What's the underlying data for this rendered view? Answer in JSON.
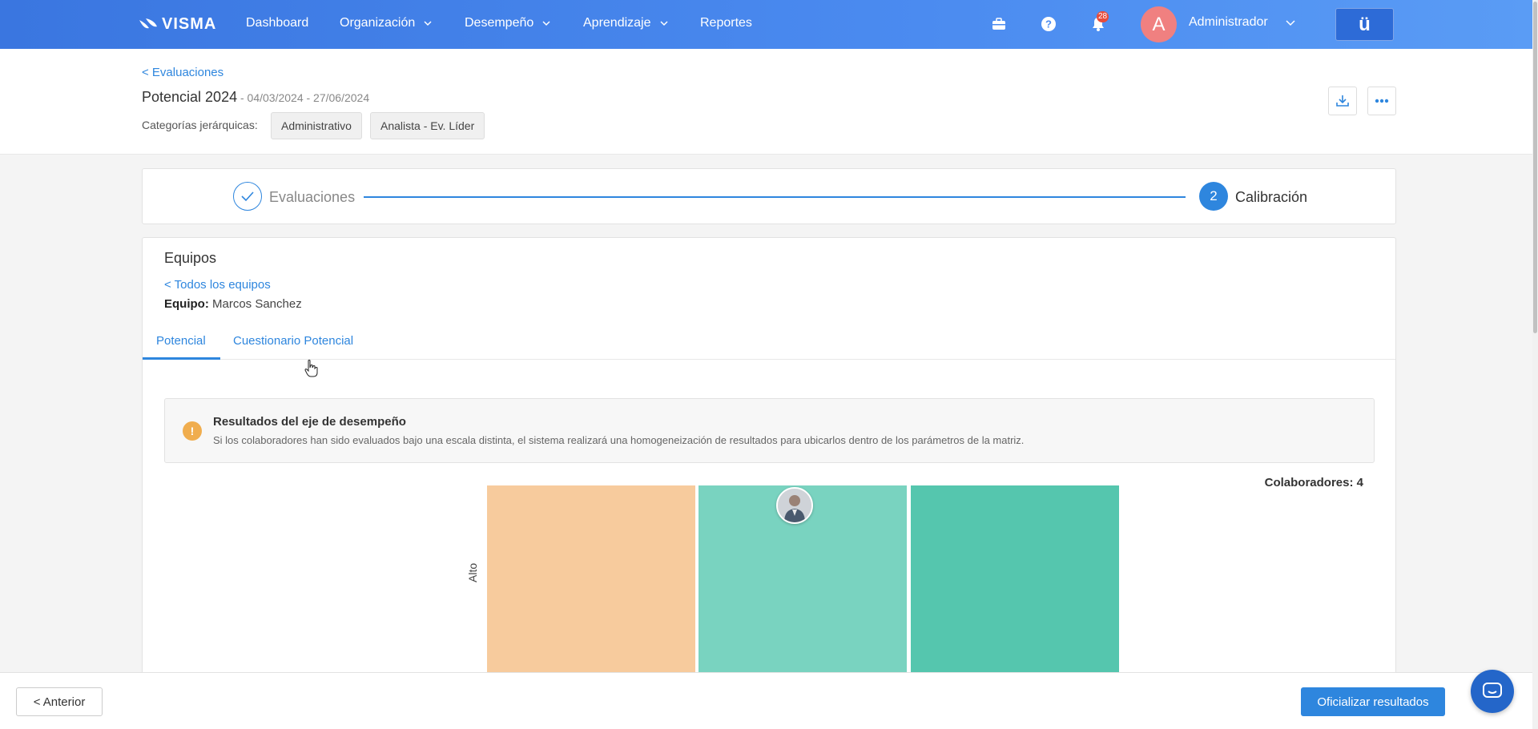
{
  "navbar": {
    "logo": "VISMA",
    "items": [
      {
        "label": "Dashboard",
        "has_dropdown": false
      },
      {
        "label": "Organización",
        "has_dropdown": true
      },
      {
        "label": "Desempeño",
        "has_dropdown": true
      },
      {
        "label": "Aprendizaje",
        "has_dropdown": true
      },
      {
        "label": "Reportes",
        "has_dropdown": false
      }
    ],
    "notifications_count": "28",
    "avatar_initial": "A",
    "user_name": "Administrador",
    "app_button_label": "ü"
  },
  "header": {
    "back_link": "< Evaluaciones",
    "title": "Potencial 2024",
    "dates": " - 04/03/2024 - 27/06/2024",
    "categories_label": "Categorías jerárquicas:",
    "categories": [
      "Administrativo",
      "Analista - Ev. Líder"
    ]
  },
  "stepper": {
    "step1_label": "Evaluaciones",
    "step2_number": "2",
    "step2_label": "Calibración"
  },
  "card": {
    "title": "Equipos",
    "all_teams_link": "< Todos los equipos",
    "team_label": "Equipo:",
    "team_name": " Marcos Sanchez",
    "tabs": [
      {
        "label": "Potencial",
        "active": true
      },
      {
        "label": "Cuestionario Potencial",
        "active": false
      }
    ],
    "alert": {
      "icon": "!",
      "title": "Resultados del eje de desempeño",
      "text": "Si los colaboradores han sido evaluados bajo una escala distinta, el sistema realizará una homogeneización de resultados para ubicarlos dentro de los parámetros de la matriz."
    },
    "collaborators_label": "Colaboradores:",
    "collaborators_count": " 4",
    "matrix": {
      "row_label": "Alto",
      "cells": [
        {
          "color": "#f7cb9d",
          "tag_color": "#b3926f"
        },
        {
          "color": "#79d3c0",
          "tag_color": "#4e9b8b"
        },
        {
          "color": "#55c6ae",
          "tag_color": "#3e9480"
        }
      ]
    }
  },
  "footer": {
    "prev_button": "< Anterior",
    "official_button": "Oficializar resultados"
  },
  "colors": {
    "accent": "#2e86de",
    "navbar": "#4b8bf0",
    "warning": "#f0ad4e"
  }
}
